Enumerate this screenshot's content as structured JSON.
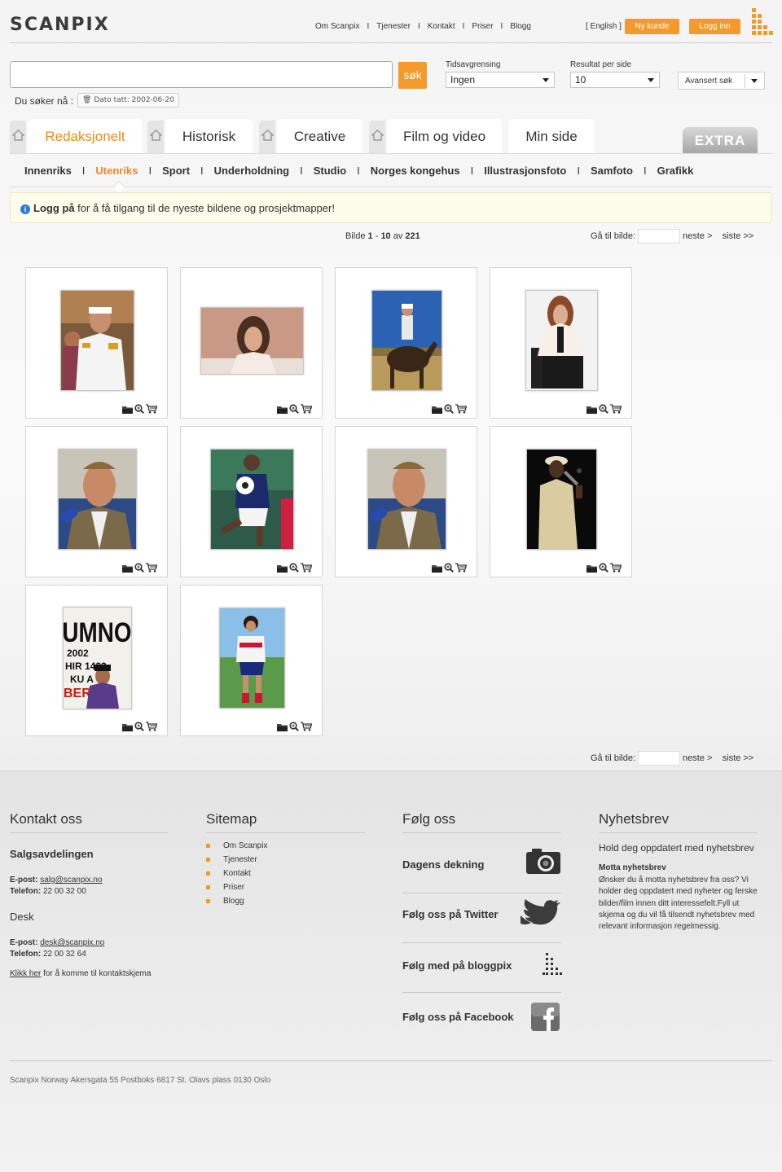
{
  "brand": {
    "logo": "SCANPIX"
  },
  "topnav": {
    "items": [
      "Om Scanpix",
      "Tjenester",
      "Kontakt",
      "Priser",
      "Blogg"
    ],
    "english": "[ English ]",
    "new_customer": "Ny kunde",
    "login": "Logg inn"
  },
  "search": {
    "value": "",
    "button": "søk",
    "tidsavgrensing_label": "Tidsavgrensing",
    "tidsavgrensing_value": "Ingen",
    "resultat_label": "Resultat per side",
    "resultat_value": "10",
    "advanced": "Avansert søk",
    "searching_label": "Du søker nå :",
    "filter_chip": "Dato tatt: 2002-06-20"
  },
  "tabs": [
    {
      "label": "Redaksjonelt",
      "active": true
    },
    {
      "label": "Historisk"
    },
    {
      "label": "Creative"
    },
    {
      "label": "Film og video"
    },
    {
      "label": "Min side"
    }
  ],
  "extra": "EXTRA",
  "categories": {
    "items": [
      "Innenriks",
      "Utenriks",
      "Sport",
      "Underholdning",
      "Studio",
      "Norges kongehus",
      "Illustrasjonsfoto",
      "Samfoto",
      "Grafikk"
    ],
    "current": "Utenriks"
  },
  "notice": {
    "bold": "Logg på",
    "text": " for å få tilgang til de nyeste bildene og prosjektmapper!"
  },
  "pager": {
    "prefix": "Bilde ",
    "from": "1",
    "dash": " - ",
    "to": "10",
    "of": " av ",
    "total": "221",
    "goto_label": "Gå til bilde:",
    "next": "neste >",
    "last": "siste >>"
  },
  "results": [
    {
      "id": 1,
      "scene": "officer"
    },
    {
      "id": 2,
      "scene": "woman-wide"
    },
    {
      "id": 3,
      "scene": "horse"
    },
    {
      "id": 4,
      "scene": "woman-chair"
    },
    {
      "id": 5,
      "scene": "man-mic"
    },
    {
      "id": 6,
      "scene": "football"
    },
    {
      "id": 7,
      "scene": "man-mic"
    },
    {
      "id": 8,
      "scene": "singer"
    },
    {
      "id": 9,
      "scene": "umno"
    },
    {
      "id": 10,
      "scene": "footballer"
    }
  ],
  "umno": {
    "big": "UMNO",
    "l1": "2002",
    "l2": "HIR 1423",
    "l3": "KU  A",
    "l4": "BER HI"
  },
  "footer": {
    "kontakt": {
      "title": "Kontakt oss",
      "salg": "Salgsavdelingen",
      "epost_label": "E-post:",
      "salg_email": "salg@scanpix.no",
      "telefon_label": "Telefon:",
      "salg_phone": "22 00 32 00",
      "desk": "Desk",
      "desk_email": "desk@scanpix.no",
      "desk_phone": "22 00 32 64",
      "klikk": "Klikk her",
      "klikk_rest": " for å komme til kontaktskjema"
    },
    "sitemap": {
      "title": "Sitemap",
      "items": [
        "Om Scanpix",
        "Tjenester",
        "Kontakt",
        "Priser",
        "Blogg"
      ]
    },
    "folg": {
      "title": "Følg oss",
      "items": [
        "Dagens dekning",
        "Følg oss på Twitter",
        "Følg med på bloggpix",
        "Følg oss på Facebook"
      ]
    },
    "nyhetsbrev": {
      "title": "Nyhetsbrev",
      "subtitle": "Hold deg oppdatert med nyhetsbrev",
      "heading": "Motta nyhetsbrev",
      "text": "Ønsker du å motta nyhetsbrev fra oss? Vi holder deg oppdatert med nyheter og ferske bilder/film innen ditt interessefelt.Fyll ut skjema og du vil få tilsendt nyhetsbrev med relevant informasjon regelmessig."
    },
    "address": "Scanpix Norway Akersgata 55 Postboks 6817 St. Olavs plass 0130 Oslo"
  },
  "colors": {
    "accent": "#f39a2a",
    "active_tab": "#f08a14",
    "info": "#2a7fd8"
  }
}
